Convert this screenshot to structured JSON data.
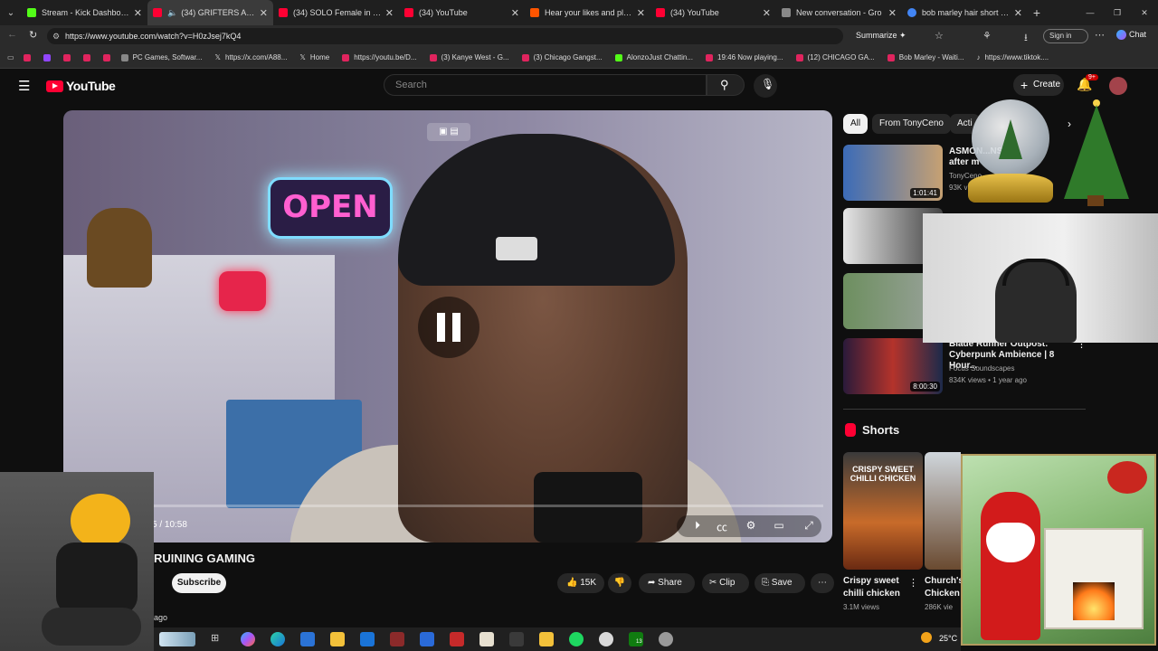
{
  "browser": {
    "tabs": [
      {
        "title": "Stream - Kick Dashboard",
        "color": "#53fc18",
        "active": false
      },
      {
        "title": "(34) GRIFTERS ARE RUIN",
        "color": "#ff0033",
        "active": true
      },
      {
        "title": "(34) SOLO Female in INDIA",
        "color": "#ff0033",
        "active": false
      },
      {
        "title": "(34) YouTube",
        "color": "#ff0033",
        "active": false
      },
      {
        "title": "Hear your likes and playlists",
        "color": "#ff5500",
        "active": false
      },
      {
        "title": "(34) YouTube",
        "color": "#ff0033",
        "active": false
      },
      {
        "title": "New conversation - Gro",
        "color": "#888888",
        "active": false
      },
      {
        "title": "bob marley hair short freefo",
        "color": "#4285f4",
        "active": false
      }
    ],
    "url": "https://www.youtube.com/watch?v=H0zJsej7kQ4",
    "summarize_label": "Summarize",
    "signin_label": "Sign in",
    "chat_label": "Chat",
    "bookmarks": [
      "PC Games, Softwar...",
      "https://x.com/A88...",
      "Home",
      "https://youtu.be/D...",
      "(3) Kanye West - G...",
      "(3) Chicago Gangst...",
      "AlonzoJust Chattin...",
      "19:46 Now playing...",
      "(12) CHICAGO GA...",
      "Bob Marley - Waiti...",
      "https://www.tiktok...."
    ]
  },
  "youtube": {
    "logo_text": "YouTube",
    "search_placeholder": "Search",
    "create_label": "Create",
    "notification_count": "9+",
    "neon_sign": "OPEN",
    "timecode": "5 / 10:58",
    "video_title": "RUINING GAMING",
    "subscribe_label": "Subscribe",
    "upload_age": "ago",
    "likes": "15K",
    "share_label": "Share",
    "clip_label": "Clip",
    "save_label": "Save",
    "chips": [
      "All",
      "From TonyCeno",
      "Acti"
    ],
    "recommendations": [
      {
        "title": "ASMON...NS",
        "title2": "after m",
        "channel": "TonyCeno",
        "meta": "93K view",
        "duration": "1:01:41"
      },
      {
        "title": "",
        "title2": "",
        "channel": "",
        "meta": "",
        "duration": ""
      },
      {
        "title": "",
        "title2": "",
        "channel": "",
        "meta": "",
        "duration": "1:"
      },
      {
        "title": "Blade Runner Outpost:",
        "title2": "Cyberpunk Ambience | 8 Hour...",
        "channel": "Focus Soundscapes",
        "meta": "834K views • 1 year ago",
        "duration": "8:00:30"
      }
    ],
    "shorts_heading": "Shorts",
    "shorts": [
      {
        "thumb_text": "CRISPY SWEET CHILLI CHICKEN",
        "title": "Crispy sweet chilli chicken",
        "views": "3.1M views"
      },
      {
        "title": "Church's Chicken",
        "views": "286K vie"
      }
    ]
  },
  "taskbar": {
    "temperature": "25°C",
    "badge": "13"
  }
}
